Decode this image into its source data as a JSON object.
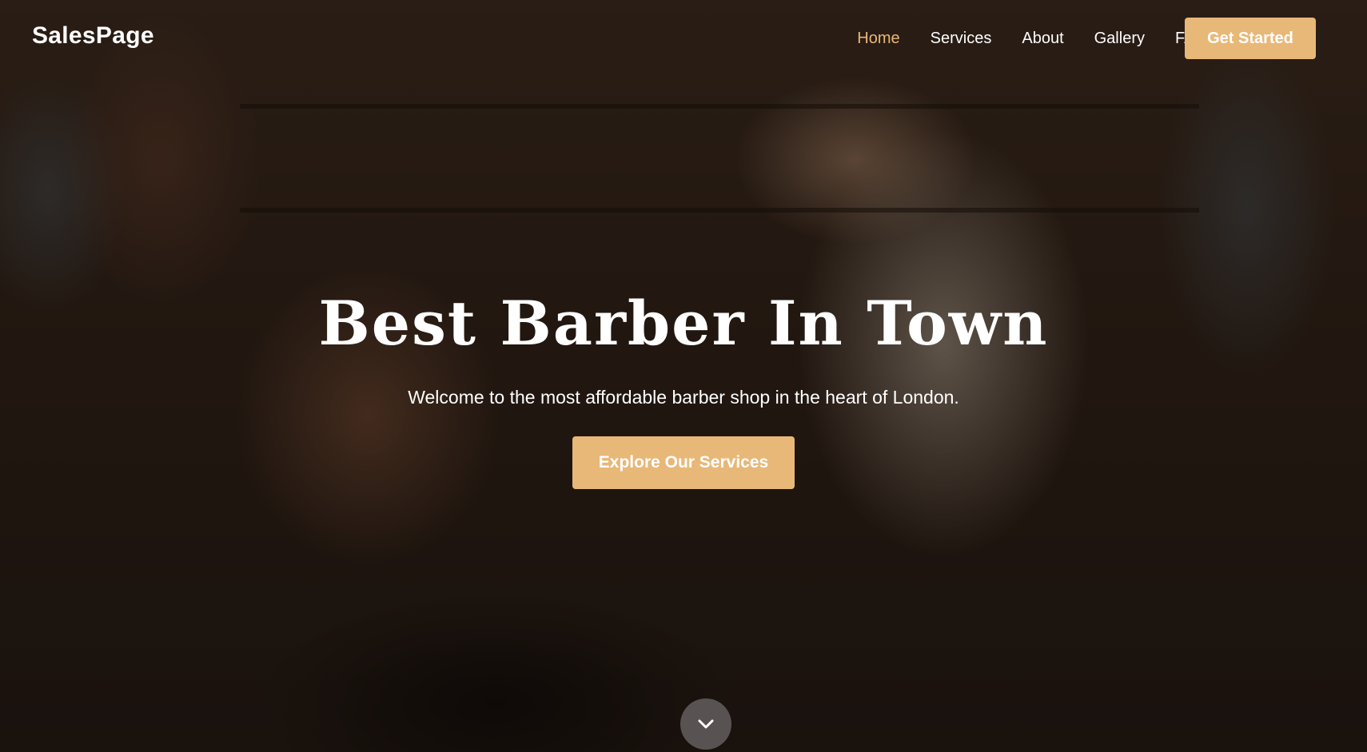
{
  "brand": {
    "name": "SalesPage",
    "accent_color": "#e8b878"
  },
  "nav": {
    "items": [
      {
        "label": "Home",
        "active": true
      },
      {
        "label": "Services",
        "active": false
      },
      {
        "label": "About",
        "active": false
      },
      {
        "label": "Gallery",
        "active": false
      },
      {
        "label": "FAQ",
        "active": false
      }
    ],
    "cta_label": "Get Started"
  },
  "hero": {
    "title": "Best Barber In Town",
    "subtitle": "Welcome to the most affordable barber shop in the heart of London.",
    "button_label": "Explore Our Services",
    "scroll_icon": "chevron-down-icon"
  }
}
